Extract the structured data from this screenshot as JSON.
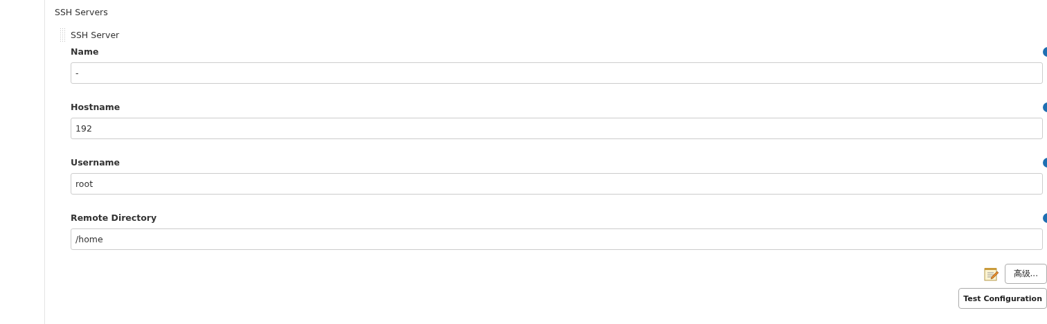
{
  "section_title": "SSH Servers",
  "server": {
    "title": "SSH Server",
    "fields": [
      {
        "label": "Name",
        "value": "-"
      },
      {
        "label": "Hostname",
        "value": "192"
      },
      {
        "label": "Username",
        "value": "root"
      },
      {
        "label": "Remote Directory",
        "value": "/home"
      }
    ],
    "buttons": [
      {
        "kind": "advanced",
        "label": "高级..."
      },
      {
        "kind": "test",
        "label": "Test Configuration"
      }
    ]
  }
}
